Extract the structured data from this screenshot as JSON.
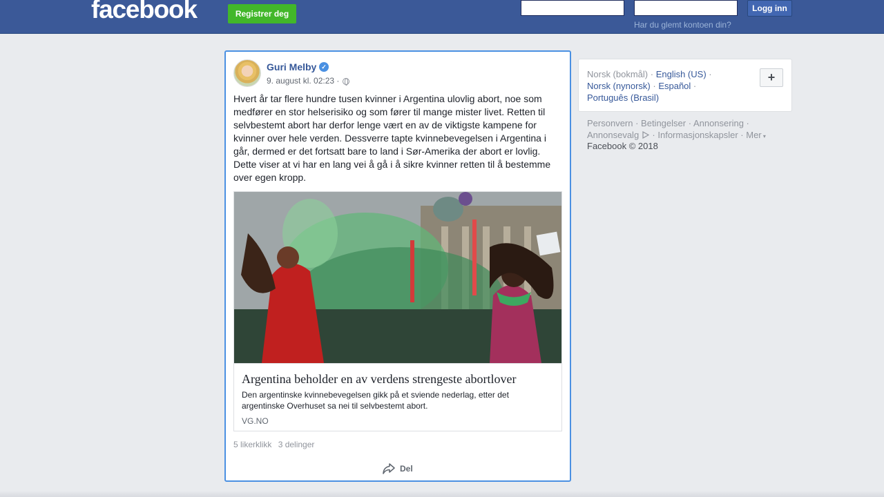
{
  "header": {
    "logo": "facebook",
    "register_label": "Registrer deg",
    "email_value": "",
    "password_value": "",
    "login_label": "Logg inn",
    "forgot_label": "Har du glemt kontoen din?"
  },
  "post": {
    "author": "Guri Melby",
    "verified": true,
    "timestamp": "9. august kl. 02:23 ·",
    "privacy_icon": "globe-icon",
    "text": "Hvert år tar flere hundre tusen kvinner i Argentina ulovlig abort, noe som medfører en stor helserisiko og som fører til mange mister livet. Retten til selvbestemt abort har derfor lenge vært en av de viktigste kampene for kvinner over hele verden. Dessverre tapte kvinnebevegelsen i Argentina i går, dermed er det fortsatt bare to land i Sør-Amerika der abort er lovlig. Dette viser at vi har en lang vei å gå i å sikre kvinner retten til å bestemme over egen kropp.",
    "link": {
      "title": "Argentina beholder en av verdens strengeste abortlover",
      "description": "Den argentinske kvinnebevegelsen gikk på et sviende nederlag, etter det argentinske Overhuset sa nei til selvbestemt abort.",
      "domain": "VG.NO"
    },
    "likes": "5 likerklikk",
    "shares": "3 delinger",
    "share_label": "Del"
  },
  "sidebar": {
    "languages": {
      "current": "Norsk (bokmål)",
      "options": [
        "English (US)",
        "Norsk (nynorsk)",
        "Español",
        "Português (Brasil)"
      ],
      "add_label": "+"
    },
    "footer": {
      "links": [
        "Personvern",
        "Betingelser",
        "Annonsering",
        "Annonsevalg",
        "Informasjonskapsler",
        "Mer"
      ],
      "copyright": "Facebook © 2018"
    }
  },
  "colors": {
    "brand": "#3b5998",
    "register_green": "#42b72a",
    "link_blue": "#365899",
    "focus_border": "#4a90e2"
  }
}
